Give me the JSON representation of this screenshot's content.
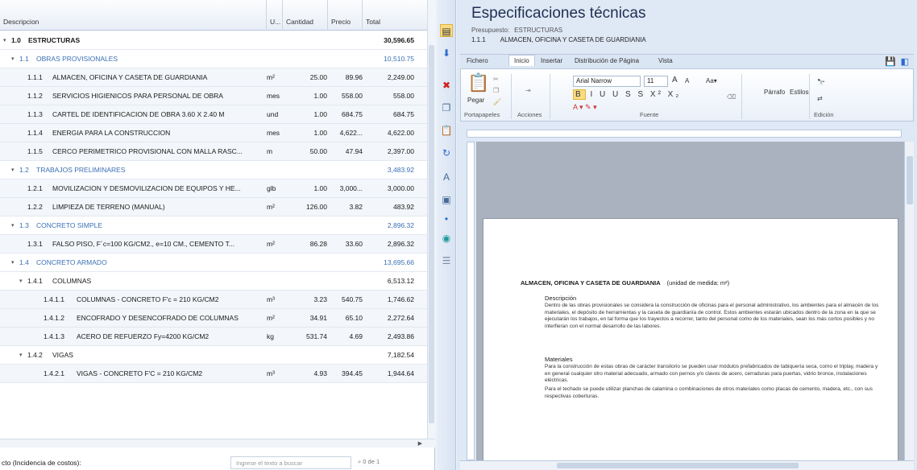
{
  "table": {
    "columns": [
      "Descripcion",
      "U...",
      "Cantidad",
      "Precio",
      "Total"
    ],
    "rows": [
      {
        "level": 0,
        "code": "1.0",
        "desc": "ESTRUCTURAS",
        "unit": "",
        "qty": "",
        "price": "",
        "total": "30,596.65",
        "type": "root"
      },
      {
        "level": 1,
        "code": "1.1",
        "desc": "OBRAS PROVISIONALES",
        "unit": "",
        "qty": "",
        "price": "",
        "total": "10,510.75",
        "type": "group"
      },
      {
        "level": 2,
        "code": "1.1.1",
        "desc": "ALMACEN, OFICINA Y CASETA DE GUARDIANIA",
        "unit": "m²",
        "qty": "25.00",
        "price": "89.96",
        "total": "2,249.00",
        "type": "item"
      },
      {
        "level": 2,
        "code": "1.1.2",
        "desc": "SERVICIOS HIGIENICOS PARA PERSONAL DE OBRA",
        "unit": "mes",
        "qty": "1.00",
        "price": "558.00",
        "total": "558.00",
        "type": "item"
      },
      {
        "level": 2,
        "code": "1.1.3",
        "desc": "CARTEL DE IDENTIFICACION DE OBRA 3.60 X 2.40 M",
        "unit": "und",
        "qty": "1.00",
        "price": "684.75",
        "total": "684.75",
        "type": "item"
      },
      {
        "level": 2,
        "code": "1.1.4",
        "desc": "ENERGIA PARA LA CONSTRUCCION",
        "unit": "mes",
        "qty": "1.00",
        "price": "4,622...",
        "total": "4,622.00",
        "type": "item"
      },
      {
        "level": 2,
        "code": "1.1.5",
        "desc": "CERCO PERIMETRICO PROVISIONAL CON MALLA RASC...",
        "unit": "m",
        "qty": "50.00",
        "price": "47.94",
        "total": "2,397.00",
        "type": "item"
      },
      {
        "level": 1,
        "code": "1.2",
        "desc": "TRABAJOS PRELIMINARES",
        "unit": "",
        "qty": "",
        "price": "",
        "total": "3,483.92",
        "type": "group"
      },
      {
        "level": 2,
        "code": "1.2.1",
        "desc": "MOVILIZACION Y DESMOVILIZACION DE EQUIPOS Y HE...",
        "unit": "glb",
        "qty": "1.00",
        "price": "3,000...",
        "total": "3,000.00",
        "type": "item"
      },
      {
        "level": 2,
        "code": "1.2.2",
        "desc": "LIMPIEZA DE TERRENO (MANUAL)",
        "unit": "m²",
        "qty": "126.00",
        "price": "3.82",
        "total": "483.92",
        "type": "item"
      },
      {
        "level": 1,
        "code": "1.3",
        "desc": "CONCRETO SIMPLE",
        "unit": "",
        "qty": "",
        "price": "",
        "total": "2,896.32",
        "type": "group"
      },
      {
        "level": 2,
        "code": "1.3.1",
        "desc": "FALSO PISO, F´c=100 KG/CM2., e=10 CM., CEMENTO T...",
        "unit": "m²",
        "qty": "86.28",
        "price": "33.60",
        "total": "2,896.32",
        "type": "item"
      },
      {
        "level": 1,
        "code": "1.4",
        "desc": "CONCRETO ARMADO",
        "unit": "",
        "qty": "",
        "price": "",
        "total": "13,695.66",
        "type": "group"
      },
      {
        "level": 2,
        "code": "1.4.1",
        "desc": "COLUMNAS",
        "unit": "",
        "qty": "",
        "price": "",
        "total": "6,513.12",
        "type": "subgroup"
      },
      {
        "level": 3,
        "code": "1.4.1.1",
        "desc": "COLUMNAS - CONCRETO F'c = 210 KG/CM2",
        "unit": "m³",
        "qty": "3.23",
        "price": "540.75",
        "total": "1,746.62",
        "type": "item"
      },
      {
        "level": 3,
        "code": "1.4.1.2",
        "desc": "ENCOFRADO Y DESENCOFRADO DE COLUMNAS",
        "unit": "m²",
        "qty": "34.91",
        "price": "65.10",
        "total": "2,272.64",
        "type": "item"
      },
      {
        "level": 3,
        "code": "1.4.1.3",
        "desc": "ACERO DE REFUERZO Fy=4200 KG/CM2",
        "unit": "kg",
        "qty": "531.74",
        "price": "4.69",
        "total": "2,493.86",
        "type": "item"
      },
      {
        "level": 2,
        "code": "1.4.2",
        "desc": "VIGAS",
        "unit": "",
        "qty": "",
        "price": "",
        "total": "7,182.54",
        "type": "subgroup"
      },
      {
        "level": 3,
        "code": "1.4.2.1",
        "desc": "VIGAS - CONCRETO F'C = 210 KG/CM2",
        "unit": "m³",
        "qty": "4.93",
        "price": "394.45",
        "total": "1,944.64",
        "type": "item"
      }
    ]
  },
  "footer": {
    "label": "cto (Incidencia de costos):",
    "search_placeholder": "Ingrese el texto a buscar",
    "nav": "0 de 1"
  },
  "spec": {
    "title": "Especificaciones técnicas",
    "presupuesto_label": "Presupuesto:",
    "presupuesto_value": "ESTRUCTURAS",
    "item_code": "1.1.1",
    "item_name": "ALMACEN, OFICINA Y CASETA DE GUARDIANIA"
  },
  "ribbon": {
    "tabs": [
      "Fichero",
      "Inicio",
      "Insertar",
      "Distribución de Página",
      "Vista"
    ],
    "active_tab": "Inicio",
    "paste_label": "Pegar",
    "groups": [
      "Portapapeles",
      "Acciones",
      "Fuente",
      "Párrafo",
      "Estilos",
      "Edición"
    ],
    "font_name": "Arial Narrow",
    "font_size": "11",
    "format_buttons": "B I U U S S X² X₂",
    "paragraph_label": "Párrafo",
    "styles_label": "Estilos"
  },
  "document": {
    "heading": "ALMACEN, OFICINA Y CASETA DE GUARDIANIA",
    "unit_note": "(unidad de medida: m²)",
    "section1_title": "Descripción",
    "section1_text": "Dentro de las obras provisionales se considera la construcción de oficinas para el personal administrativo, los ambientes para el almacén de los materiales, el depósito de herramientas y la caseta de guardianía de control. Estos ambientes estarán ubicados dentro de la zona en la que se ejecutarán los trabajos, en tal forma que los trayectos a recorrer, tanto del personal como de los materiales, sean los más cortos posibles y no interfieran con el normal desarrollo de las labores.",
    "section2_title": "Materiales",
    "section2_text": "Para la construcción de estas obras de carácter transitorio se pueden usar módulos prefabricados de tabiquería seca, como el triplay, madera y en general cualquier otro material adecuado, armado con pernos y/o clavos de acero, cerraduras para puertas, vidrio bronce, instalaciones eléctricas.",
    "section2_text2": "Para el techado se puede utilizar planchas de calamina o combinaciones de otros materiales como placas de cemento, madera, etc., con sus respectivas coberturas."
  },
  "colors": {
    "group_text": "#3a6fb5",
    "accent": "#f9dc83",
    "pane_bg": "#dfe8f5"
  }
}
